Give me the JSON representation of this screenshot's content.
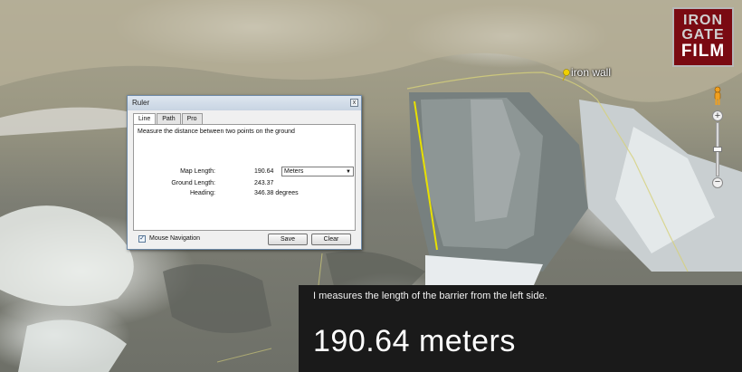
{
  "logo": {
    "line1": "IRON",
    "line2": "GATE",
    "line3": "FILM"
  },
  "placemark": {
    "label": "iron wall",
    "icon": "pushpin-icon",
    "color": "#f0d000"
  },
  "navigation": {
    "zoom_in": "+",
    "zoom_out": "−",
    "pegman_icon": "street-view-person-icon"
  },
  "ruler": {
    "title": "Ruler",
    "close": "x",
    "tabs": [
      {
        "label": "Line",
        "active": true
      },
      {
        "label": "Path",
        "active": false
      },
      {
        "label": "Pro",
        "active": false
      }
    ],
    "description": "Measure the distance between two points on the ground",
    "map_length_label": "Map Length:",
    "map_length_value": "190.64",
    "units": {
      "selected": "Meters"
    },
    "ground_length_label": "Ground Length:",
    "ground_length_value": "243.37",
    "heading_label": "Heading:",
    "heading_value": "346.38 degrees",
    "mouse_navigation_label": "Mouse Navigation",
    "mouse_navigation_checked": true,
    "save_label": "Save",
    "clear_label": "Clear"
  },
  "caption": {
    "subtitle": "I measures the length of the barrier from the left side.",
    "headline": "190.64 meters"
  },
  "colors": {
    "measure_line": "#e8e000",
    "logo_bg": "#7a0a12",
    "caption_bg": "#1a1a1a"
  }
}
